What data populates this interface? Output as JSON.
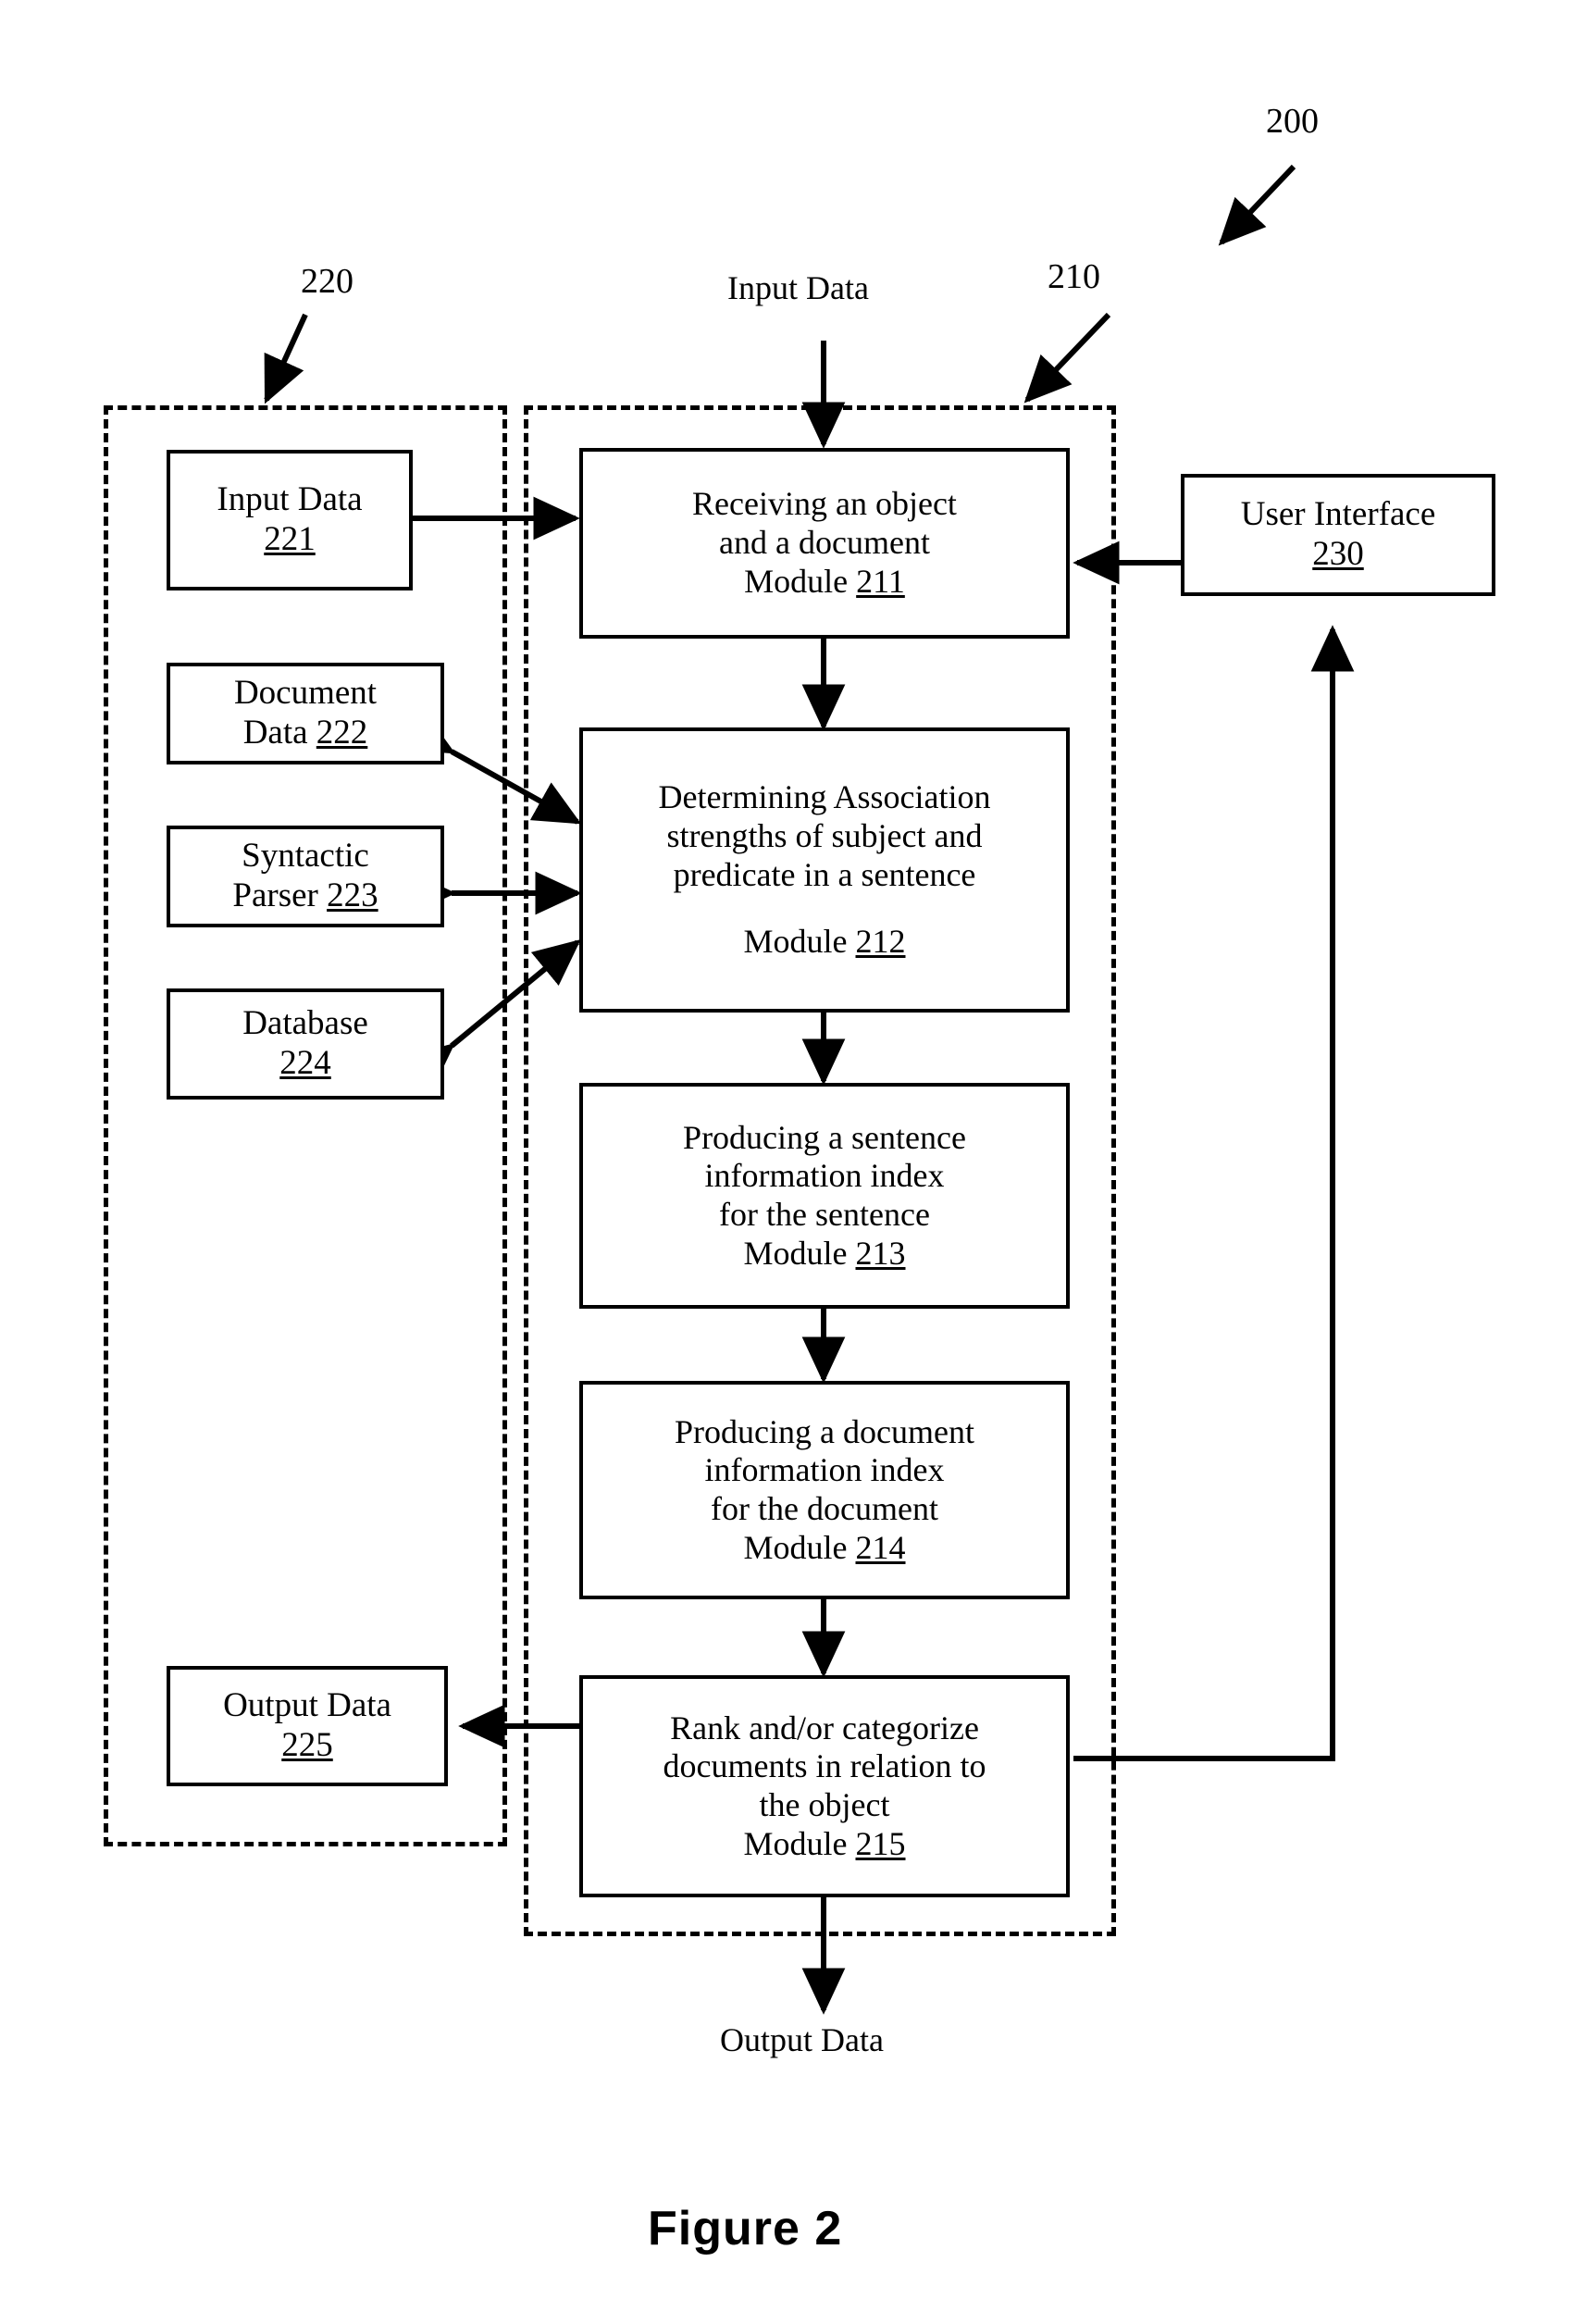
{
  "figure": {
    "caption": "Figure 2",
    "system_ref": "200",
    "engine_ref": "210",
    "data_store_ref": "220"
  },
  "flow_labels": {
    "input_data_top": "Input Data",
    "output_data_bottom": "Output Data"
  },
  "data_group": {
    "ref": "220",
    "boxes": [
      {
        "lines": [
          "Input Data"
        ],
        "ref": "221",
        "ref_inline": false
      },
      {
        "lines": [
          "Document",
          "Data"
        ],
        "ref": "222",
        "ref_inline": true
      },
      {
        "lines": [
          "Syntactic",
          "Parser"
        ],
        "ref": "223",
        "ref_inline": true
      },
      {
        "lines": [
          "Database"
        ],
        "ref": "224",
        "ref_inline": false
      },
      {
        "lines": [
          "Output Data"
        ],
        "ref": "225",
        "ref_inline": false
      }
    ]
  },
  "engine_group": {
    "ref": "210",
    "modules": [
      {
        "lines": [
          "Receiving an object",
          "and a document"
        ],
        "module_label": "Module",
        "ref": "211",
        "gap_before_module": false
      },
      {
        "lines": [
          "Determining Association",
          "strengths of subject and",
          "predicate in a sentence"
        ],
        "module_label": "Module",
        "ref": "212",
        "gap_before_module": true
      },
      {
        "lines": [
          "Producing a sentence",
          "information index",
          "for the sentence"
        ],
        "module_label": "Module",
        "ref": "213",
        "gap_before_module": false
      },
      {
        "lines": [
          "Producing a document",
          "information index",
          "for the document"
        ],
        "module_label": "Module",
        "ref": "214",
        "gap_before_module": false
      },
      {
        "lines": [
          "Rank and/or categorize",
          "documents in relation to",
          "the object"
        ],
        "module_label": "Module",
        "ref": "215",
        "gap_before_module": false
      }
    ]
  },
  "user_interface": {
    "lines": [
      "User Interface"
    ],
    "ref": "230"
  },
  "colors": {
    "stroke": "#000000",
    "background": "#ffffff"
  }
}
